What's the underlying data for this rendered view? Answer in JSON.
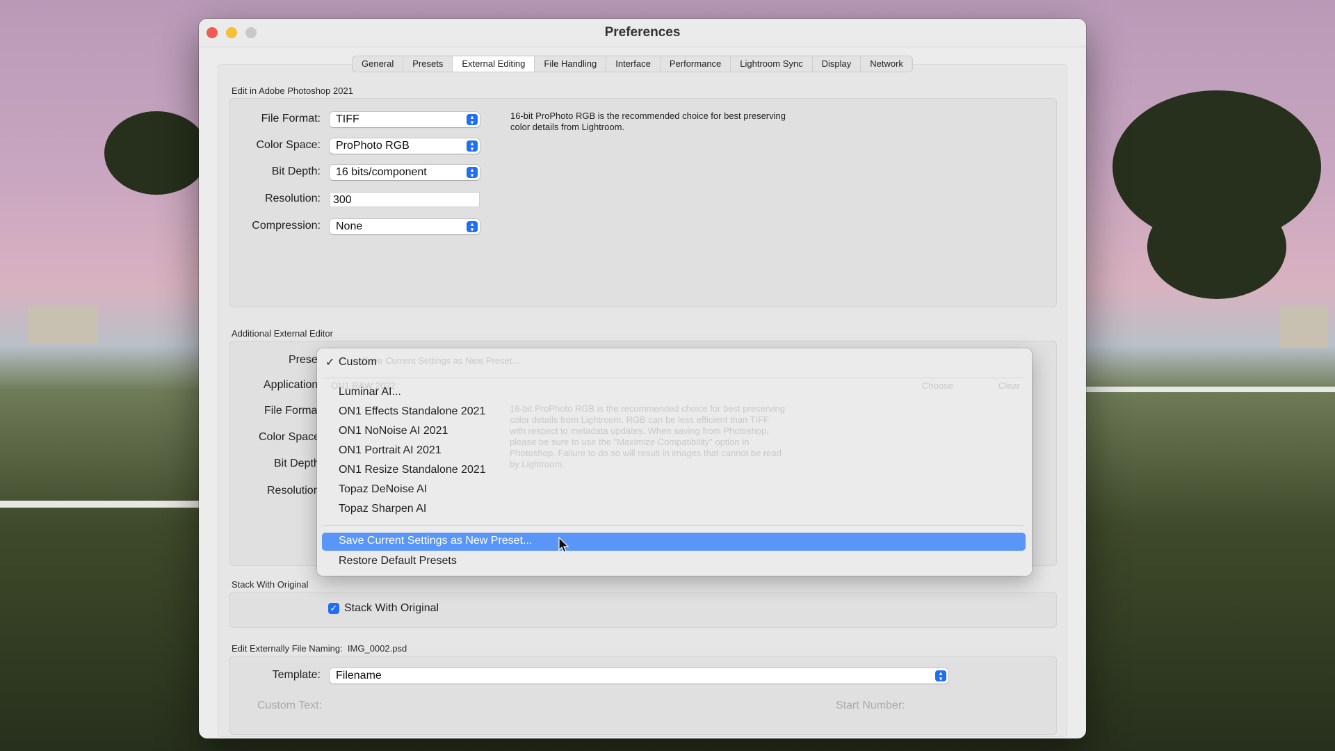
{
  "window": {
    "title": "Preferences"
  },
  "tabs": [
    {
      "label": "General"
    },
    {
      "label": "Presets"
    },
    {
      "label": "External Editing"
    },
    {
      "label": "File Handling"
    },
    {
      "label": "Interface"
    },
    {
      "label": "Performance"
    },
    {
      "label": "Lightroom Sync"
    },
    {
      "label": "Display"
    },
    {
      "label": "Network"
    }
  ],
  "active_tab": "External Editing",
  "photoshop": {
    "section_title": "Edit in Adobe Photoshop 2021",
    "file_format": {
      "label": "File Format:",
      "value": "TIFF"
    },
    "color_space": {
      "label": "Color Space:",
      "value": "ProPhoto RGB"
    },
    "bit_depth": {
      "label": "Bit Depth:",
      "value": "16 bits/component"
    },
    "resolution": {
      "label": "Resolution:",
      "value": "300"
    },
    "compression": {
      "label": "Compression:",
      "value": "None"
    },
    "note_line1": "16-bit ProPhoto RGB is the recommended choice for best preserving",
    "note_line2": "color details from Lightroom."
  },
  "additional": {
    "section_title": "Additional External Editor",
    "preset_label": "Prese",
    "application_label": "Application",
    "file_format_label": "File Forma",
    "color_space_label": "Color Space",
    "bit_depth_label": "Bit Depth",
    "resolution_label": "Resolution",
    "ghost_preset": "Save Current Settings as New Preset...",
    "ghost_app": "ON1 RAW 2022",
    "ghost_choose": "Choose",
    "ghost_clear": "Clear",
    "ghost_note": [
      "16-bit ProPhoto RGB is the recommended choice for best preserving",
      "color details from Lightroom. RGB can be less efficient than TIFF",
      "with respect to metadata updates. When saving from Photoshop,",
      "please be sure to use the \"Maximize Compatibility\" option in",
      "Photoshop. Failure to do so will result in images that cannot be read",
      "by Lightroom."
    ]
  },
  "preset_menu": {
    "items_top": [
      {
        "label": "Custom",
        "checked": true
      }
    ],
    "items": [
      {
        "label": "Luminar AI..."
      },
      {
        "label": "ON1 Effects Standalone 2021"
      },
      {
        "label": "ON1 NoNoise AI 2021"
      },
      {
        "label": "ON1 Portrait AI 2021"
      },
      {
        "label": "ON1 Resize Standalone 2021"
      },
      {
        "label": "Topaz DeNoise AI"
      },
      {
        "label": "Topaz Sharpen AI"
      }
    ],
    "actions": [
      {
        "label": "Save Current Settings as New Preset...",
        "highlighted": true
      },
      {
        "label": "Restore Default Presets"
      }
    ],
    "checkmark": "✓"
  },
  "stack": {
    "section_title": "Stack With Original",
    "checkbox_label": "Stack With Original",
    "checked": true
  },
  "naming": {
    "section_title": "Edit Externally File Naming:",
    "example": "IMG_0002.psd",
    "template_label": "Template:",
    "template_value": "Filename",
    "custom_text_label": "Custom Text:",
    "start_number_label": "Start Number:"
  },
  "colors": {
    "accent": "#1f6ef5",
    "highlight": "#5a96f8",
    "close": "#ee5b52",
    "minimize": "#f5bf38",
    "zoom": "#c9c9c9"
  }
}
